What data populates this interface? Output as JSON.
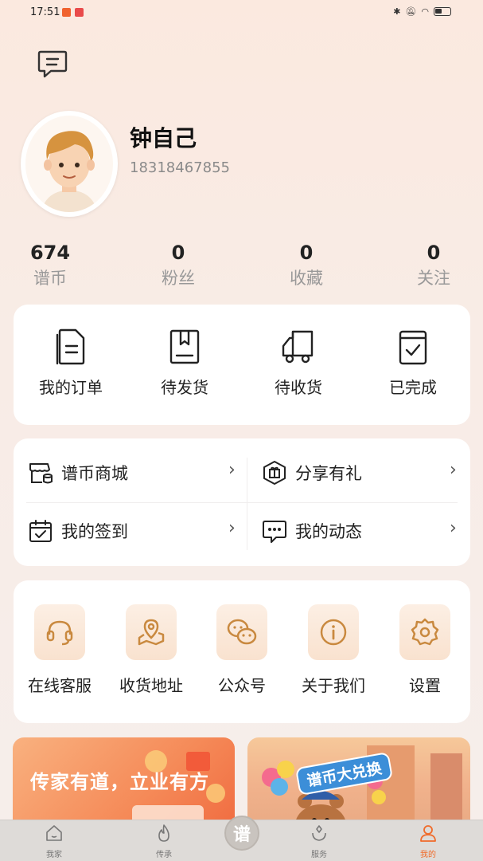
{
  "status_bar": {
    "time": "17:51"
  },
  "profile": {
    "name": "钟自己",
    "phone": "18318467855"
  },
  "stats": [
    {
      "value": "674",
      "label": "谱币"
    },
    {
      "value": "0",
      "label": "粉丝"
    },
    {
      "value": "0",
      "label": "收藏"
    },
    {
      "value": "0",
      "label": "关注"
    }
  ],
  "orders": [
    {
      "label": "我的订单",
      "icon": "document-icon"
    },
    {
      "label": "待发货",
      "icon": "box-icon"
    },
    {
      "label": "待收货",
      "icon": "truck-icon"
    },
    {
      "label": "已完成",
      "icon": "check-icon"
    }
  ],
  "menu": [
    {
      "label": "谱币商城",
      "icon": "shop-icon"
    },
    {
      "label": "分享有礼",
      "icon": "gift-icon"
    },
    {
      "label": "我的签到",
      "icon": "calendar-check-icon"
    },
    {
      "label": "我的动态",
      "icon": "chat-dots-icon"
    }
  ],
  "services": [
    {
      "label": "在线客服",
      "icon": "headset-icon"
    },
    {
      "label": "收货地址",
      "icon": "map-pin-icon"
    },
    {
      "label": "公众号",
      "icon": "wechat-icon"
    },
    {
      "label": "关于我们",
      "icon": "info-icon"
    },
    {
      "label": "设置",
      "icon": "gear-icon"
    }
  ],
  "banners": {
    "left_text": "传家有道，立业有方",
    "right_title": "谱币大兑换"
  },
  "tabbar": {
    "items": [
      "我家",
      "传承",
      "服务",
      "我的"
    ],
    "center": "谱",
    "active": "我的"
  },
  "colors": {
    "accent": "#f06b2a",
    "icon_gold": "#c9893f"
  }
}
